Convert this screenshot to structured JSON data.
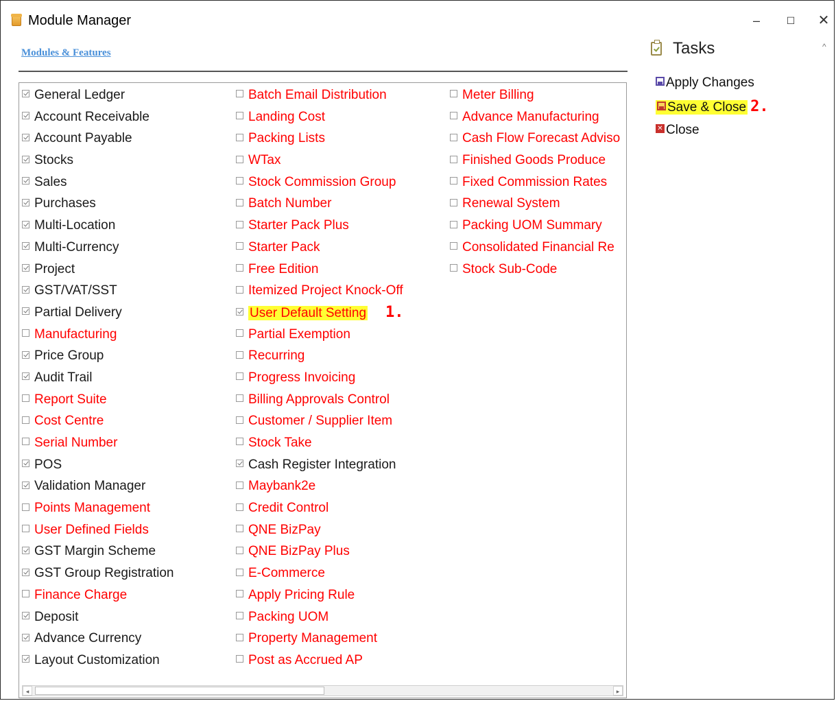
{
  "window": {
    "title": "Module Manager",
    "controls": {
      "minimize": "–",
      "maximize": "☐",
      "close": "✕"
    }
  },
  "modules_link": "Modules & Features",
  "columns": [
    [
      {
        "label": "General Ledger",
        "checked": true,
        "color": "black"
      },
      {
        "label": "Account Receivable",
        "checked": true,
        "color": "black"
      },
      {
        "label": "Account Payable",
        "checked": true,
        "color": "black"
      },
      {
        "label": "Stocks",
        "checked": true,
        "color": "black"
      },
      {
        "label": "Sales",
        "checked": true,
        "color": "black"
      },
      {
        "label": "Purchases",
        "checked": true,
        "color": "black"
      },
      {
        "label": "Multi-Location",
        "checked": true,
        "color": "black"
      },
      {
        "label": "Multi-Currency",
        "checked": true,
        "color": "black"
      },
      {
        "label": "Project",
        "checked": true,
        "color": "black"
      },
      {
        "label": "GST/VAT/SST",
        "checked": true,
        "color": "black"
      },
      {
        "label": "Partial Delivery",
        "checked": true,
        "color": "black"
      },
      {
        "label": "Manufacturing",
        "checked": false,
        "color": "red"
      },
      {
        "label": "Price Group",
        "checked": true,
        "color": "black"
      },
      {
        "label": "Audit Trail",
        "checked": true,
        "color": "black"
      },
      {
        "label": "Report Suite",
        "checked": false,
        "color": "red"
      },
      {
        "label": "Cost Centre",
        "checked": false,
        "color": "red"
      },
      {
        "label": "Serial Number",
        "checked": false,
        "color": "red"
      },
      {
        "label": "POS",
        "checked": true,
        "color": "black"
      },
      {
        "label": "Validation Manager",
        "checked": true,
        "color": "black"
      },
      {
        "label": "Points Management",
        "checked": false,
        "color": "red"
      },
      {
        "label": "User Defined Fields",
        "checked": false,
        "color": "red"
      },
      {
        "label": "GST Margin Scheme",
        "checked": true,
        "color": "black"
      },
      {
        "label": "GST Group Registration",
        "checked": true,
        "color": "black"
      },
      {
        "label": "Finance Charge",
        "checked": false,
        "color": "red"
      },
      {
        "label": "Deposit",
        "checked": true,
        "color": "black"
      },
      {
        "label": "Advance Currency",
        "checked": true,
        "color": "black"
      },
      {
        "label": "Layout Customization",
        "checked": true,
        "color": "black"
      }
    ],
    [
      {
        "label": "Batch Email Distribution",
        "checked": false,
        "color": "red"
      },
      {
        "label": "Landing Cost",
        "checked": false,
        "color": "red"
      },
      {
        "label": "Packing Lists",
        "checked": false,
        "color": "red"
      },
      {
        "label": "WTax",
        "checked": false,
        "color": "red"
      },
      {
        "label": "Stock Commission Group",
        "checked": false,
        "color": "red"
      },
      {
        "label": "Batch Number",
        "checked": false,
        "color": "red"
      },
      {
        "label": "Starter Pack Plus",
        "checked": false,
        "color": "red"
      },
      {
        "label": "Starter Pack",
        "checked": false,
        "color": "red"
      },
      {
        "label": "Free Edition",
        "checked": false,
        "color": "red"
      },
      {
        "label": "Itemized Project Knock-Off",
        "checked": false,
        "color": "red"
      },
      {
        "label": "User Default Setting",
        "checked": true,
        "color": "red",
        "highlight": true,
        "step": "1."
      },
      {
        "label": "Partial Exemption",
        "checked": false,
        "color": "red"
      },
      {
        "label": "Recurring",
        "checked": false,
        "color": "red"
      },
      {
        "label": "Progress Invoicing",
        "checked": false,
        "color": "red"
      },
      {
        "label": "Billing Approvals Control",
        "checked": false,
        "color": "red"
      },
      {
        "label": "Customer / Supplier Item",
        "checked": false,
        "color": "red"
      },
      {
        "label": "Stock Take",
        "checked": false,
        "color": "red"
      },
      {
        "label": "Cash Register Integration",
        "checked": true,
        "color": "black"
      },
      {
        "label": "Maybank2e",
        "checked": false,
        "color": "red"
      },
      {
        "label": "Credit Control",
        "checked": false,
        "color": "red"
      },
      {
        "label": "QNE BizPay",
        "checked": false,
        "color": "red"
      },
      {
        "label": "QNE BizPay Plus",
        "checked": false,
        "color": "red"
      },
      {
        "label": "E-Commerce",
        "checked": false,
        "color": "red"
      },
      {
        "label": "Apply Pricing Rule",
        "checked": false,
        "color": "red"
      },
      {
        "label": "Packing UOM",
        "checked": false,
        "color": "red"
      },
      {
        "label": "Property Management",
        "checked": false,
        "color": "red"
      },
      {
        "label": "Post as Accrued AP",
        "checked": false,
        "color": "red"
      }
    ],
    [
      {
        "label": "Meter Billing",
        "checked": false,
        "color": "red"
      },
      {
        "label": "Advance Manufacturing",
        "checked": false,
        "color": "red"
      },
      {
        "label": "Cash Flow Forecast Adviso",
        "checked": false,
        "color": "red"
      },
      {
        "label": "Finished Goods Produce",
        "checked": false,
        "color": "red"
      },
      {
        "label": "Fixed Commission Rates",
        "checked": false,
        "color": "red"
      },
      {
        "label": "Renewal System",
        "checked": false,
        "color": "red"
      },
      {
        "label": "Packing UOM Summary",
        "checked": false,
        "color": "red"
      },
      {
        "label": "Consolidated Financial Re",
        "checked": false,
        "color": "red"
      },
      {
        "label": "Stock Sub-Code",
        "checked": false,
        "color": "red"
      }
    ]
  ],
  "scrollbar": {
    "left_arrow": "◂",
    "right_arrow": "▸"
  },
  "tasks": {
    "title": "Tasks",
    "collapse": "^",
    "apply_label": "Apply Changes",
    "save_close_label": "Save & Close",
    "save_close_step": "2.",
    "close_label": "Close",
    "close_icon_glyph": "✕"
  },
  "colors": {
    "red_label": "#ff0000",
    "highlight": "#ffff33",
    "link": "#4a90d9"
  }
}
